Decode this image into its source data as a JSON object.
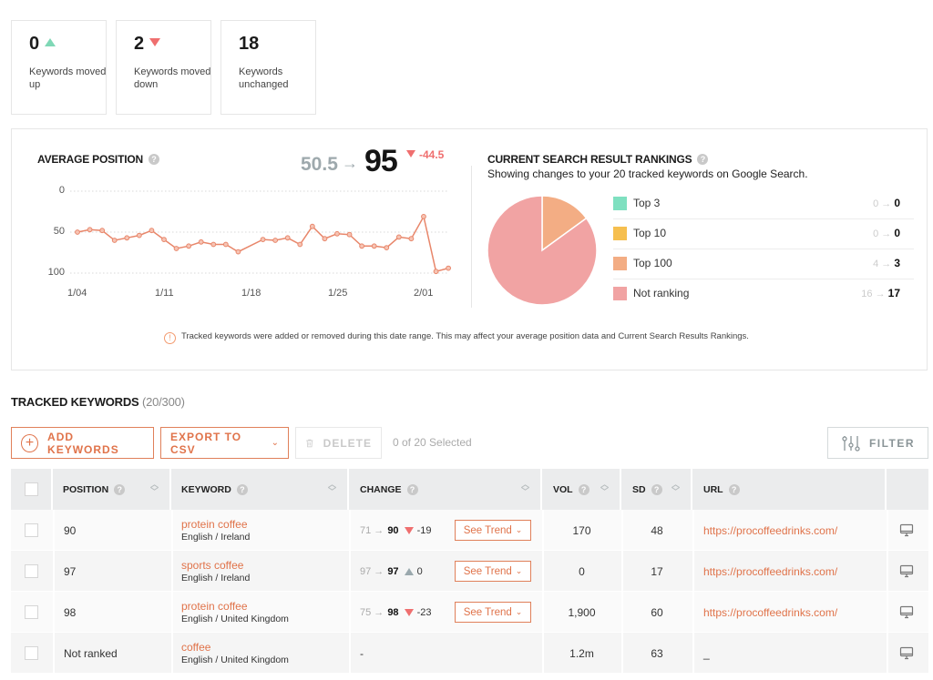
{
  "stats": [
    {
      "value": "0",
      "direction": "up",
      "label": "Keywords moved up"
    },
    {
      "value": "2",
      "direction": "down",
      "label": "Keywords moved down"
    },
    {
      "value": "18",
      "direction": "none",
      "label": "Keywords unchanged"
    }
  ],
  "average_position": {
    "title": "AVERAGE POSITION",
    "help_icon": "?",
    "old_value": "50.5",
    "arrow": "→",
    "new_value": "95",
    "delta": "-44.5"
  },
  "current_rankings": {
    "title": "CURRENT SEARCH RESULT RANKINGS",
    "help_icon": "?",
    "subtitle": "Showing changes to your 20 tracked keywords on Google Search.",
    "legend": [
      {
        "name": "Top 3",
        "color": "#7fe0c0",
        "from": "0",
        "to": "0"
      },
      {
        "name": "Top 10",
        "color": "#f6bf4f",
        "from": "0",
        "to": "0"
      },
      {
        "name": "Top 100",
        "color": "#f3ad84",
        "from": "4",
        "to": "3"
      },
      {
        "name": "Not ranking",
        "color": "#f1a3a3",
        "from": "16",
        "to": "17"
      }
    ]
  },
  "notice": {
    "icon": "info-icon",
    "text": "Tracked keywords were added or removed during this date range. This may affect your average position data and Current Search Results Rankings."
  },
  "chart_data": [
    {
      "type": "line",
      "title": "AVERAGE POSITION",
      "xlabel": "",
      "ylabel": "",
      "y_inverted": true,
      "ylim": [
        0,
        100
      ],
      "yticks": [
        "0",
        "50",
        "100"
      ],
      "xticks": [
        "1/04",
        "1/11",
        "1/18",
        "1/25",
        "2/01"
      ],
      "grid": true,
      "color": "#e8866a",
      "x": [
        "1/04",
        "1/05",
        "1/06",
        "1/07",
        "1/08",
        "1/09",
        "1/10",
        "1/11",
        "1/12",
        "1/13",
        "1/14",
        "1/15",
        "1/16",
        "1/17",
        "1/18",
        "1/19",
        "1/20",
        "1/21",
        "1/22",
        "1/23",
        "1/24",
        "1/25",
        "1/26",
        "1/27",
        "1/28",
        "1/29",
        "1/30",
        "1/31",
        "2/01",
        "2/02",
        "2/03"
      ],
      "values": [
        50,
        47,
        48,
        60,
        57,
        54,
        48,
        59,
        70,
        67,
        62,
        65,
        65,
        74,
        null,
        59,
        60,
        57,
        65,
        43,
        58,
        52,
        53,
        67,
        67,
        69,
        56,
        58,
        31,
        98,
        94
      ]
    },
    {
      "type": "pie",
      "title": "CURRENT SEARCH RESULT RANKINGS",
      "categories": [
        "Top 3",
        "Top 10",
        "Top 100",
        "Not ranking"
      ],
      "values": [
        0,
        0,
        3,
        17
      ],
      "colors": [
        "#7fe0c0",
        "#f6bf4f",
        "#f3ad84",
        "#f1a3a3"
      ],
      "legend": "right"
    }
  ],
  "tracked": {
    "title": "TRACKED KEYWORDS",
    "count": "(20/300)",
    "add_label": "ADD KEYWORDS",
    "export_label": "EXPORT TO CSV",
    "delete_label": "DELETE",
    "selected": "0 of 20 Selected",
    "filter_label": "FILTER",
    "columns": [
      "POSITION",
      "KEYWORD",
      "CHANGE",
      "VOL",
      "SD",
      "URL"
    ],
    "rows": [
      {
        "position": "90",
        "keyword": "protein coffee",
        "locale": "English / Ireland",
        "from": "71",
        "to": "90",
        "dir": "down",
        "delta": "-19",
        "trend": "See Trend",
        "vol": "170",
        "sd": "48",
        "url": "https://procoffeedrinks.com/"
      },
      {
        "position": "97",
        "keyword": "sports coffee",
        "locale": "English / Ireland",
        "from": "97",
        "to": "97",
        "dir": "up",
        "delta": "0",
        "trend": "See Trend",
        "vol": "0",
        "sd": "17",
        "url": "https://procoffeedrinks.com/"
      },
      {
        "position": "98",
        "keyword": "protein coffee",
        "locale": "English / United Kingdom",
        "from": "75",
        "to": "98",
        "dir": "down",
        "delta": "-23",
        "trend": "See Trend",
        "vol": "1,900",
        "sd": "60",
        "url": "https://procoffeedrinks.com/"
      },
      {
        "position": "Not ranked",
        "keyword": "coffee",
        "locale": "English / United Kingdom",
        "change_text": "-",
        "vol": "1.2m",
        "sd": "63",
        "url": "_"
      }
    ]
  }
}
